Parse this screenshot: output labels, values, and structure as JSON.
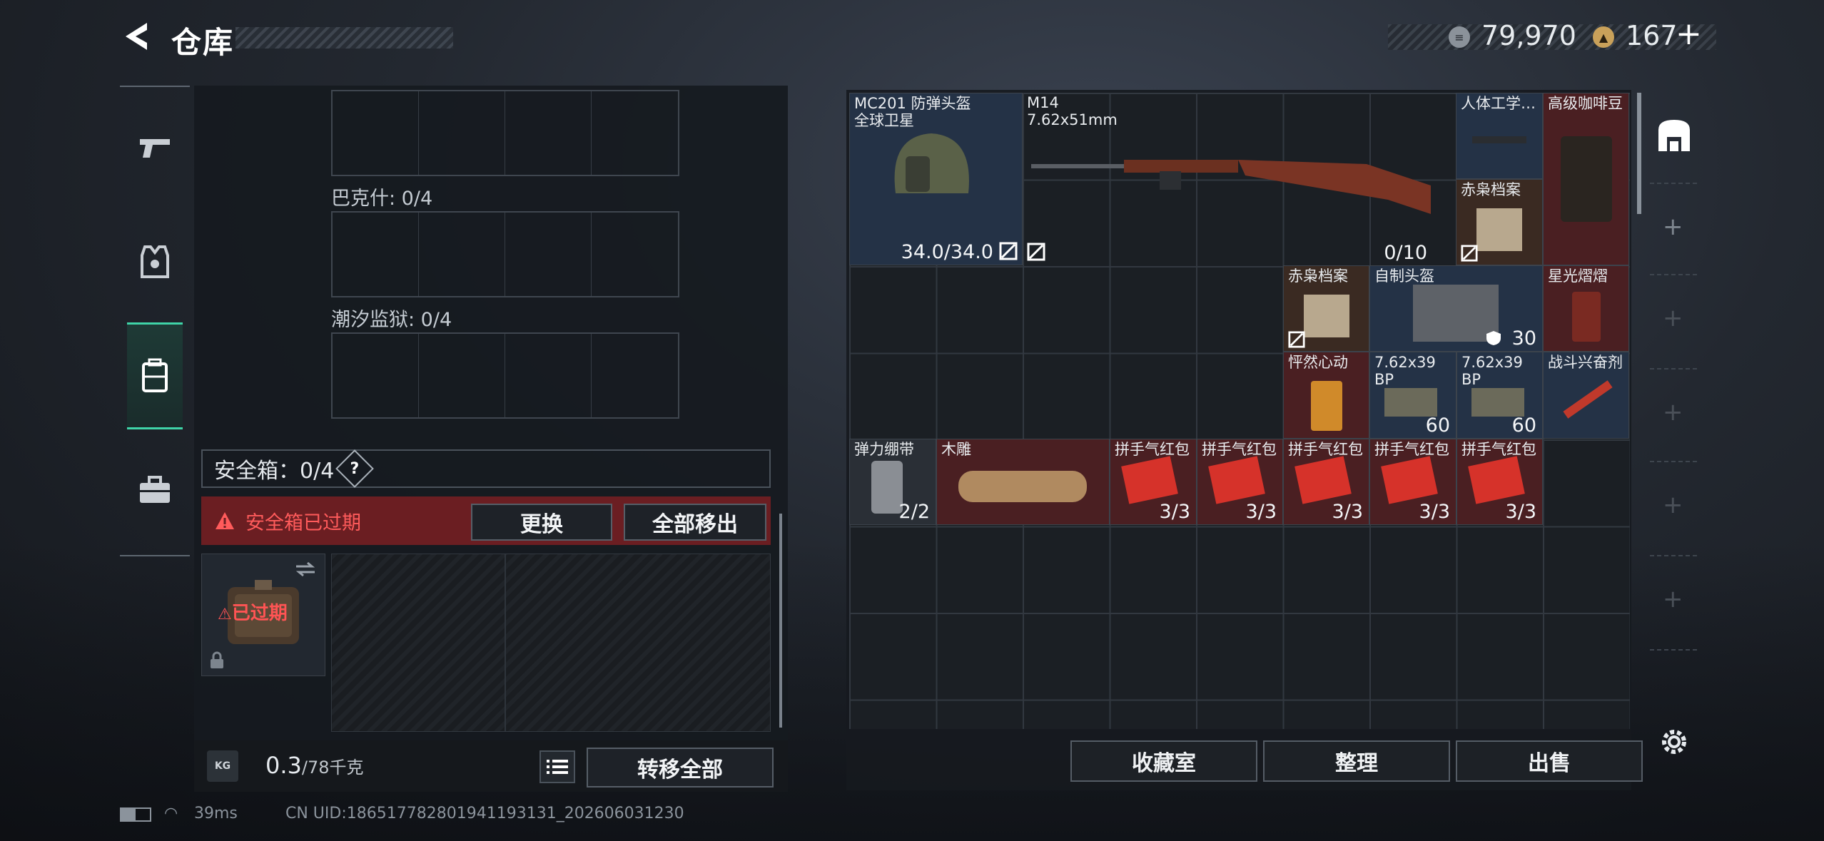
{
  "header": {
    "title": "仓库"
  },
  "currency": [
    {
      "icon": "silver-coin-icon",
      "value": "79,970"
    },
    {
      "icon": "gold-coin-icon",
      "value": "167"
    }
  ],
  "left_panel": {
    "slot_groups": [
      {
        "label": "巴克什: 0/4"
      },
      {
        "label": "潮汐监狱: 0/4"
      }
    ],
    "safe_box": {
      "label": "安全箱：0/4",
      "help": "?"
    },
    "warning": {
      "text": "安全箱已过期"
    },
    "replace_button": "更换",
    "move_all_out_button": "全部移出",
    "expired_badge": "已过期",
    "weight": {
      "current": "0.3",
      "max": "/78千克",
      "icon_text": "KG"
    },
    "transfer_all_button": "转移全部"
  },
  "items": [
    {
      "name": "MC201 防弹头盔",
      "sub": "全球卫星",
      "count": "34.0/34.0"
    },
    {
      "name": "M14",
      "sub": "7.62x51mm",
      "count": "0/10"
    },
    {
      "name": "人体工学…",
      "count": ""
    },
    {
      "name": "高级咖啡豆",
      "count": ""
    },
    {
      "name": "赤枭档案",
      "count": ""
    },
    {
      "name": "赤枭档案",
      "count": ""
    },
    {
      "name": "自制头盔",
      "count": "30"
    },
    {
      "name": "星光熠熠",
      "count": ""
    },
    {
      "name": "怦然心动",
      "count": ""
    },
    {
      "name": "7.62x39 BP",
      "count": "60"
    },
    {
      "name": "7.62x39 BP",
      "count": "60"
    },
    {
      "name": "战斗兴奋剂",
      "count": ""
    },
    {
      "name": "弹力绷带",
      "count": "2/2"
    },
    {
      "name": "木雕",
      "count": ""
    },
    {
      "name": "拼手气红包",
      "count": "3/3"
    },
    {
      "name": "拼手气红包",
      "count": "3/3"
    },
    {
      "name": "拼手气红包",
      "count": "3/3"
    },
    {
      "name": "拼手气红包",
      "count": "3/3"
    },
    {
      "name": "拼手气红包",
      "count": "3/3"
    }
  ],
  "bottom_buttons": {
    "collection": "收藏室",
    "organize": "整理",
    "sell": "出售"
  },
  "status_bar": {
    "ping": "39ms",
    "uid": "CN UID:186517782801941193131_202606031230"
  }
}
